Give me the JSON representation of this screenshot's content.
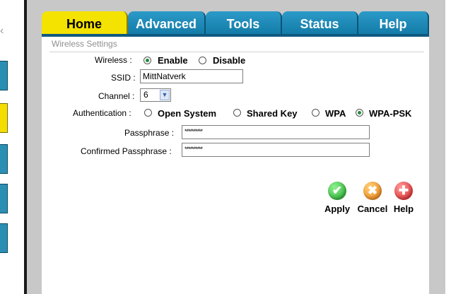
{
  "tabs": [
    {
      "label": "Home",
      "active": true
    },
    {
      "label": "Advanced",
      "active": false
    },
    {
      "label": "Tools",
      "active": false
    },
    {
      "label": "Status",
      "active": false
    },
    {
      "label": "Help",
      "active": false
    }
  ],
  "section": {
    "title": "Wireless Settings"
  },
  "wireless": {
    "label": "Wireless :",
    "options": [
      "Enable",
      "Disable"
    ],
    "selected": "Enable"
  },
  "ssid": {
    "label": "SSID :",
    "value": "MittNatverk"
  },
  "channel": {
    "label": "Channel :",
    "value": "6"
  },
  "authentication": {
    "label": "Authentication :",
    "options": [
      "Open System",
      "Shared Key",
      "WPA",
      "WPA-PSK"
    ],
    "selected": "WPA-PSK"
  },
  "passphrase": {
    "label": "Passphrase :",
    "value": "**********"
  },
  "confirmed_passphrase": {
    "label": "Confirmed Passphrase :",
    "value": "**********"
  },
  "actions": {
    "apply": {
      "label": "Apply",
      "icon": "check-icon"
    },
    "cancel": {
      "label": "Cancel",
      "icon": "x-icon"
    },
    "help": {
      "label": "Help",
      "icon": "plus-icon"
    }
  },
  "colors": {
    "tab_blue": "#1a86b6",
    "tab_active": "#f4e200",
    "apply_green": "#1ea92a",
    "cancel_orange": "#ee7c0d",
    "help_red": "#dd1d1d"
  }
}
